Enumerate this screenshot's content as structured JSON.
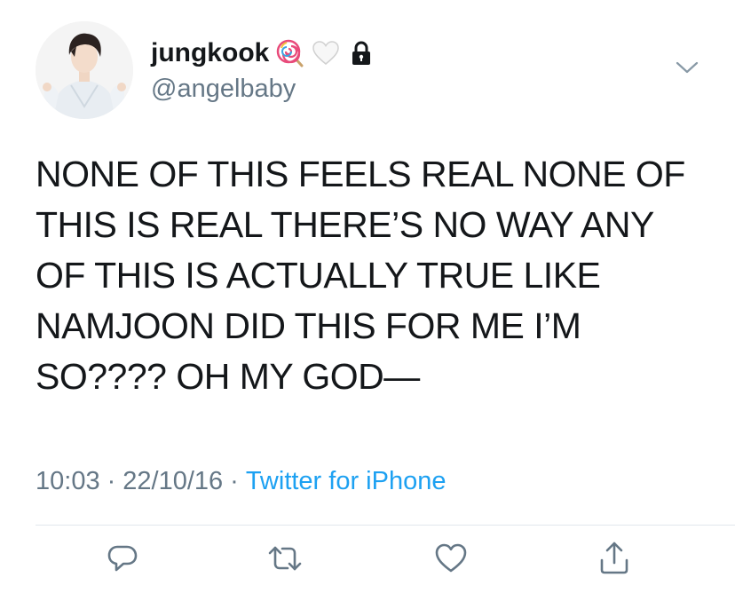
{
  "tweet": {
    "display_name": "jungkook",
    "name_emojis": [
      "lollipop-emoji",
      "white-heart-emoji",
      "lock-icon"
    ],
    "handle": "@angelbaby",
    "text": "NONE OF THIS FEELS REAL NONE OF\nTHIS IS REAL THERE’S NO WAY ANY\nOF THIS IS ACTUALLY TRUE LIKE\nNAMJOON DID THIS FOR ME I’M\nSO???? OH MY GOD—",
    "time": "10:03",
    "separator": "·",
    "date": "22/10/16",
    "source": "Twitter for iPhone"
  },
  "actions": [
    "reply-icon",
    "retweet-icon",
    "like-icon",
    "share-icon"
  ],
  "colors": {
    "text": "#14171a",
    "secondary": "#657786",
    "link": "#1da1f2",
    "divider": "#e1e8ed"
  }
}
